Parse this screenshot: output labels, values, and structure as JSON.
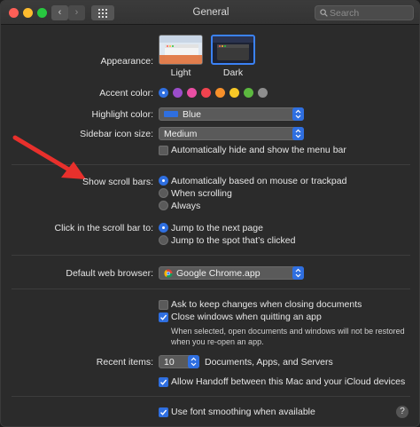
{
  "window": {
    "title": "General",
    "search_placeholder": "Search"
  },
  "appearance": {
    "label": "Appearance:",
    "options": [
      {
        "name": "Light"
      },
      {
        "name": "Dark"
      }
    ],
    "selected": "Dark"
  },
  "accent": {
    "label": "Accent color:",
    "colors": [
      "#2f6fe0",
      "#9b4dca",
      "#e94ea3",
      "#f1434f",
      "#f7902a",
      "#f7c826",
      "#5cb83f",
      "#8e8e8e"
    ]
  },
  "highlight": {
    "label": "Highlight color:",
    "value": "Blue"
  },
  "sidebar_icon": {
    "label": "Sidebar icon size:",
    "value": "Medium",
    "autohide": "Automatically hide and show the menu bar"
  },
  "scroll_bars": {
    "label": "Show scroll bars:",
    "options": [
      "Automatically based on mouse or trackpad",
      "When scrolling",
      "Always"
    ]
  },
  "scroll_click": {
    "label": "Click in the scroll bar to:",
    "options": [
      "Jump to the next page",
      "Jump to the spot that’s clicked"
    ]
  },
  "browser": {
    "label": "Default web browser:",
    "value": "Google Chrome.app"
  },
  "documents": {
    "ask_keep": "Ask to keep changes when closing documents",
    "close_windows": "Close windows when quitting an app",
    "note_line1": "When selected, open documents and windows will not be restored",
    "note_line2": "when you re-open an app."
  },
  "recent": {
    "label": "Recent items:",
    "value": "10",
    "suffix": "Documents, Apps, and Servers"
  },
  "handoff": "Allow Handoff between this Mac and your iCloud devices",
  "font_smoothing": "Use font smoothing when available",
  "help": "?"
}
